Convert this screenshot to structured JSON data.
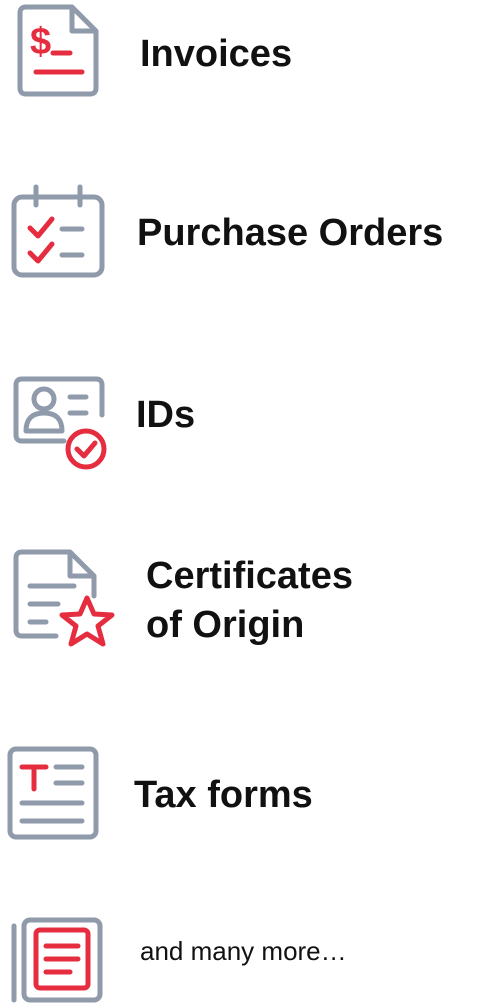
{
  "colors": {
    "gray": "#8f9aaa",
    "red": "#e52d3f",
    "text": "#111111"
  },
  "items": [
    {
      "icon": "invoice-dollar-icon",
      "label": "Invoices"
    },
    {
      "icon": "calendar-checklist-icon",
      "label": "Purchase Orders"
    },
    {
      "icon": "id-card-check-icon",
      "label": "IDs"
    },
    {
      "icon": "certificate-star-icon",
      "label_line1": "Certificates",
      "label_line2": "of Origin"
    },
    {
      "icon": "tax-form-icon",
      "label": "Tax forms"
    },
    {
      "icon": "document-stack-icon",
      "label": "and many more…"
    }
  ]
}
